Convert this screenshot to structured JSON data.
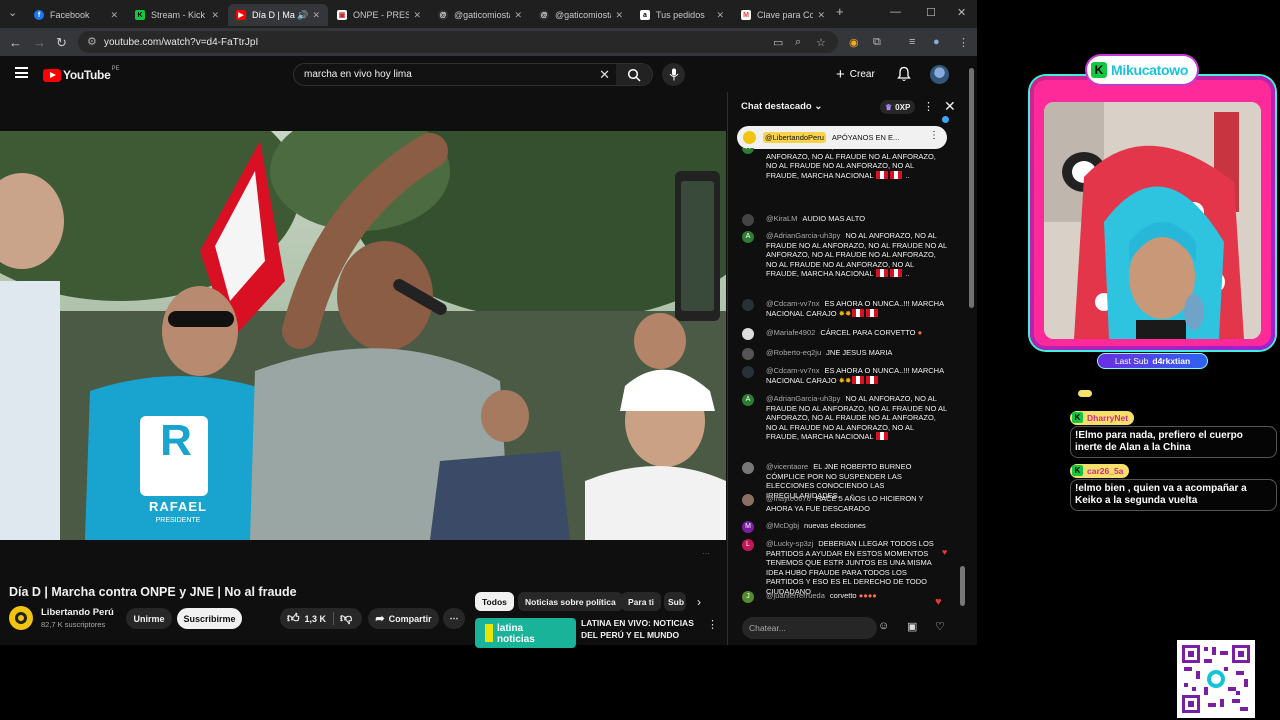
{
  "browser": {
    "tabs": [
      {
        "label": "Facebook",
        "icon": "facebook-icon",
        "color": "#1877f2"
      },
      {
        "label": "Stream - Kick D",
        "icon": "kick-icon",
        "color": "#12c842"
      },
      {
        "label": "Día D | Mar",
        "icon": "youtube-icon",
        "color": "#ff0000",
        "active": true
      },
      {
        "label": "ONPE - PRESE",
        "icon": "onpe-icon",
        "color": "#c62828"
      },
      {
        "label": "@gaticomiosta",
        "icon": "threads-icon",
        "color": "#333333"
      },
      {
        "label": "@gaticomiosta",
        "icon": "threads-icon",
        "color": "#333333"
      },
      {
        "label": "Tus pedidos",
        "icon": "amazon-icon",
        "color": "#ffffff"
      },
      {
        "label": "Clave para Con",
        "icon": "gmail-icon",
        "color": "#ea4335"
      }
    ],
    "url": "youtube.com/watch?v=d4-FaTtrJpI"
  },
  "youtube": {
    "logo_text": "YouTube",
    "country": "PE",
    "search_value": "marcha en vivo hoy lima",
    "create_label": "Crear"
  },
  "video": {
    "title": "Día D | Marcha contra ONPE y JNE | No al fraude",
    "channel": "Libertando Perú",
    "subscribers": "82,7 K suscriptores",
    "join_label": "Unirme",
    "subscribe_label": "Suscribirme",
    "likes": "1,3 K",
    "share_label": "Compartir",
    "shirt_letter": "R",
    "shirt_text": "RAFAEL",
    "shirt_sub": "PRESIDENTE"
  },
  "recommendations": {
    "chips": [
      "Todos",
      "Noticias sobre política",
      "Para ti",
      "Sub"
    ],
    "first": {
      "title": "LATINA EN VIVO: NOTICIAS DEL PERÚ Y EL MUNDO",
      "thumb_text": "latina noticias"
    }
  },
  "chat": {
    "header": "Chat destacado",
    "xp": "0XP",
    "pinned_author": "@LibertandoPeru",
    "pinned_text": "APÓYANOS EN E...",
    "input_placeholder": "Chatear...",
    "messages": [
      {
        "author": "",
        "text": "NO AL ANFORAZO, NO AL FRAUDE NO AL ANFORAZO, NO AL FRAUDE NO AL ANFORAZO, NO AL FRAUDE NO AL ANFORAZO, NO AL FRAUDE, MARCHA NACIONAL",
        "suffix": "..",
        "color": "#2e7d32",
        "letter": "A"
      },
      {
        "author": "@KiraLM",
        "text": "AUDIO MAS ALTO",
        "suffix": "",
        "color": "#444444",
        "letter": ""
      },
      {
        "author": "@AdrianGarcia-uh3py",
        "text": "NO AL ANFORAZO, NO AL FRAUDE NO AL ANFORAZO, NO AL FRAUDE NO AL ANFORAZO, NO AL FRAUDE NO AL ANFORAZO, NO AL FRAUDE NO AL ANFORAZO, NO AL FRAUDE, MARCHA NACIONAL",
        "suffix": "..",
        "color": "#2e7d32",
        "letter": "A"
      },
      {
        "author": "@Cdcam-vv7nx",
        "text": "ES AHORA O NUNCA..!!! MARCHA NACIONAL CARAJO",
        "suffix": "",
        "color": "#263238",
        "letter": ""
      },
      {
        "author": "@Mariafe4902",
        "text": "CÁRCEL PARA CORVETTO",
        "suffix": "",
        "color": "#dddddd",
        "letter": ""
      },
      {
        "author": "@Roberto-eq2ju",
        "text": "JNE JESUS MARIA",
        "suffix": "",
        "color": "#555555",
        "letter": ""
      },
      {
        "author": "@Cdcam-vv7nx",
        "text": "ES AHORA O NUNCA..!!! MARCHA NACIONAL CARAJO",
        "suffix": "",
        "color": "#263238",
        "letter": ""
      },
      {
        "author": "@AdrianGarcia-uh3py",
        "text": "NO AL ANFORAZO, NO AL FRAUDE NO AL ANFORAZO, NO AL FRAUDE NO AL ANFORAZO, NO AL FRAUDE NO AL ANFORAZO, NO AL FRAUDE NO AL ANFORAZO, NO AL FRAUDE, MARCHA NACIONAL",
        "suffix": "",
        "color": "#2e7d32",
        "letter": "A"
      },
      {
        "author": "@vicentaore",
        "text": "EL JNE ROBERTO BURNEO CÓMPLICE POR NO SUSPENDER LAS ELECCIONES CONOCIENDO LAS IRREGULARIDADES.",
        "suffix": "",
        "color": "#777777",
        "letter": ""
      },
      {
        "author": "@mayte0676",
        "text": "HACE 5 AÑOS LO HICIERON Y AHORA YA FUE DESCARADO",
        "suffix": "",
        "color": "#8d6e63",
        "letter": ""
      },
      {
        "author": "@McDgbj",
        "text": "nuevas elecciones",
        "suffix": "",
        "color": "#7b1fa2",
        "letter": "M"
      },
      {
        "author": "@Lucky-sp3zj",
        "text": "DEBERIAN LLEGAR TODOS LOS PARTIDOS A AYUDAR EN ESTOS MOMENTOS TENEMOS QUE ESTR JUNTOS ES UNA MISMA IDEA HUBO FRAUDE PARA TODOS LOS PARTIDOS Y ESO ES EL DERECHO DE TODO CIUDADANO",
        "suffix": "",
        "color": "#c2185b",
        "letter": "L"
      },
      {
        "author": "@juanferrerrueda",
        "text": "corvetto",
        "suffix": "",
        "color": "#558b2f",
        "letter": "J"
      }
    ]
  },
  "overlay": {
    "brand": "Mikucatowo",
    "last_sub_label": "Last Sub",
    "last_sub_name": "d4rkxtian",
    "kick_chat": [
      {
        "user": "DharryNet",
        "text": "!Elmo para nada, prefiero el cuerpo inerte de Alan a la China"
      },
      {
        "user": "car26_5a",
        "text": "!elmo bien , quien va a acompañar a Keiko a la segunda vuelta"
      }
    ]
  },
  "colors": {
    "youtube_red": "#ff0000",
    "kick_green": "#12c842",
    "overlay_pink": "#ff2a9a",
    "overlay_cyan": "#3ff0e0"
  }
}
